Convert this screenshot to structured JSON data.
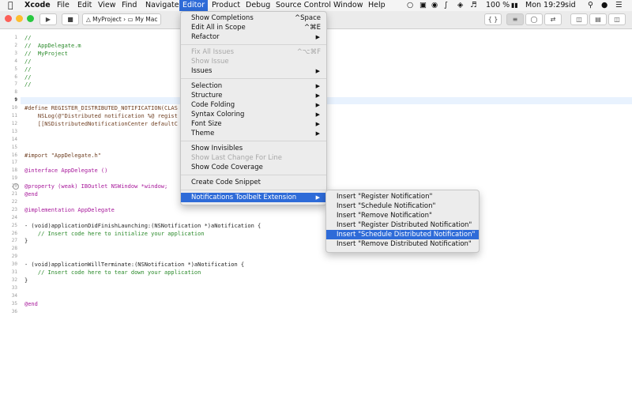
{
  "menubar": {
    "items": [
      "Xcode",
      "File",
      "Edit",
      "View",
      "Find",
      "Navigate",
      "Editor",
      "Product",
      "Debug",
      "Source Control",
      "Window",
      "Help"
    ],
    "active": "Editor",
    "battery": "100 %",
    "clock": "Mon 19:29",
    "user": "sid"
  },
  "toolbar": {
    "scheme": "MyProject",
    "destination": "My Mac"
  },
  "gutter_current_line": "9",
  "code_lines": [
    {
      "n": "1",
      "t": "//",
      "c": "com"
    },
    {
      "n": "2",
      "t": "//  AppDelegate.m",
      "c": "com"
    },
    {
      "n": "3",
      "t": "//  MyProject",
      "c": "com"
    },
    {
      "n": "4",
      "t": "//",
      "c": "com"
    },
    {
      "n": "5",
      "t": "//",
      "c": "com"
    },
    {
      "n": "6",
      "t": "//",
      "c": "com"
    },
    {
      "n": "7",
      "t": "//",
      "c": "com"
    },
    {
      "n": "8",
      "t": "",
      "c": ""
    },
    {
      "n": "9",
      "t": "",
      "c": ""
    },
    {
      "n": "10",
      "t": "#define REGISTER_DISTRIBUTED_NOTIFICATION(CLAS",
      "c": "pre"
    },
    {
      "n": "11",
      "t": "    NSLog(@\"Distributed notification %@ regist",
      "c": "str"
    },
    {
      "n": "12",
      "t": "    [[NSDistributedNotificationCenter defaultC",
      "c": "typ"
    },
    {
      "n": "13",
      "t": "",
      "c": ""
    },
    {
      "n": "14",
      "t": "",
      "c": ""
    },
    {
      "n": "15",
      "t": "",
      "c": ""
    },
    {
      "n": "16",
      "t": "#import \"AppDelegate.h\"",
      "c": "pre"
    },
    {
      "n": "17",
      "t": "",
      "c": ""
    },
    {
      "n": "18",
      "t": "@interface AppDelegate ()",
      "c": "kw"
    },
    {
      "n": "19",
      "t": "",
      "c": ""
    },
    {
      "n": "20",
      "t": "@property (weak) IBOutlet NSWindow *window;",
      "c": "kw"
    },
    {
      "n": "21",
      "t": "@end",
      "c": "kw"
    },
    {
      "n": "22",
      "t": "",
      "c": ""
    },
    {
      "n": "23",
      "t": "@implementation AppDelegate",
      "c": "kw"
    },
    {
      "n": "24",
      "t": "",
      "c": ""
    },
    {
      "n": "25",
      "t": "- (void)applicationDidFinishLaunching:(NSNotification *)aNotification {",
      "c": ""
    },
    {
      "n": "26",
      "t": "    // Insert code here to initialize your application",
      "c": "com"
    },
    {
      "n": "27",
      "t": "}",
      "c": ""
    },
    {
      "n": "28",
      "t": "",
      "c": ""
    },
    {
      "n": "29",
      "t": "",
      "c": ""
    },
    {
      "n": "30",
      "t": "- (void)applicationWillTerminate:(NSNotification *)aNotification {",
      "c": ""
    },
    {
      "n": "31",
      "t": "    // Insert code here to tear down your application",
      "c": "com"
    },
    {
      "n": "32",
      "t": "}",
      "c": ""
    },
    {
      "n": "33",
      "t": "",
      "c": ""
    },
    {
      "n": "34",
      "t": "",
      "c": ""
    },
    {
      "n": "35",
      "t": "@end",
      "c": "kw"
    },
    {
      "n": "36",
      "t": "",
      "c": ""
    }
  ],
  "editor_menu": [
    {
      "label": "Show Completions",
      "shortcut": "^Space"
    },
    {
      "label": "Edit All in Scope",
      "shortcut": "^⌘E"
    },
    {
      "label": "Refactor",
      "arrow": true
    },
    {
      "sep": true
    },
    {
      "label": "Fix All Issues",
      "shortcut": "^⌥⌘F",
      "disabled": true
    },
    {
      "label": "Show Issue",
      "disabled": true
    },
    {
      "label": "Issues",
      "arrow": true
    },
    {
      "sep": true
    },
    {
      "label": "Selection",
      "arrow": true
    },
    {
      "label": "Structure",
      "arrow": true
    },
    {
      "label": "Code Folding",
      "arrow": true
    },
    {
      "label": "Syntax Coloring",
      "arrow": true
    },
    {
      "label": "Font Size",
      "arrow": true
    },
    {
      "label": "Theme",
      "arrow": true
    },
    {
      "sep": true
    },
    {
      "label": "Show Invisibles"
    },
    {
      "label": "Show Last Change For Line",
      "disabled": true
    },
    {
      "label": "Show Code Coverage"
    },
    {
      "sep": true
    },
    {
      "label": "Create Code Snippet"
    },
    {
      "sep": true
    },
    {
      "label": "Notifications Toolbelt Extension",
      "arrow": true,
      "highlighted": true
    }
  ],
  "submenu": [
    {
      "label": "Insert \"Register Notification\""
    },
    {
      "label": "Insert \"Schedule Notification\""
    },
    {
      "label": "Insert \"Remove Notification\""
    },
    {
      "label": "Insert \"Register Distributed Notification\""
    },
    {
      "label": "Insert \"Schedule Distributed Notification\"",
      "highlighted": true
    },
    {
      "label": "Insert \"Remove Distributed Notification\""
    }
  ],
  "colors": {
    "accent": "#2e6bd8",
    "comment": "#2a8a2a",
    "keyword": "#a7179a",
    "string": "#c41a16"
  }
}
